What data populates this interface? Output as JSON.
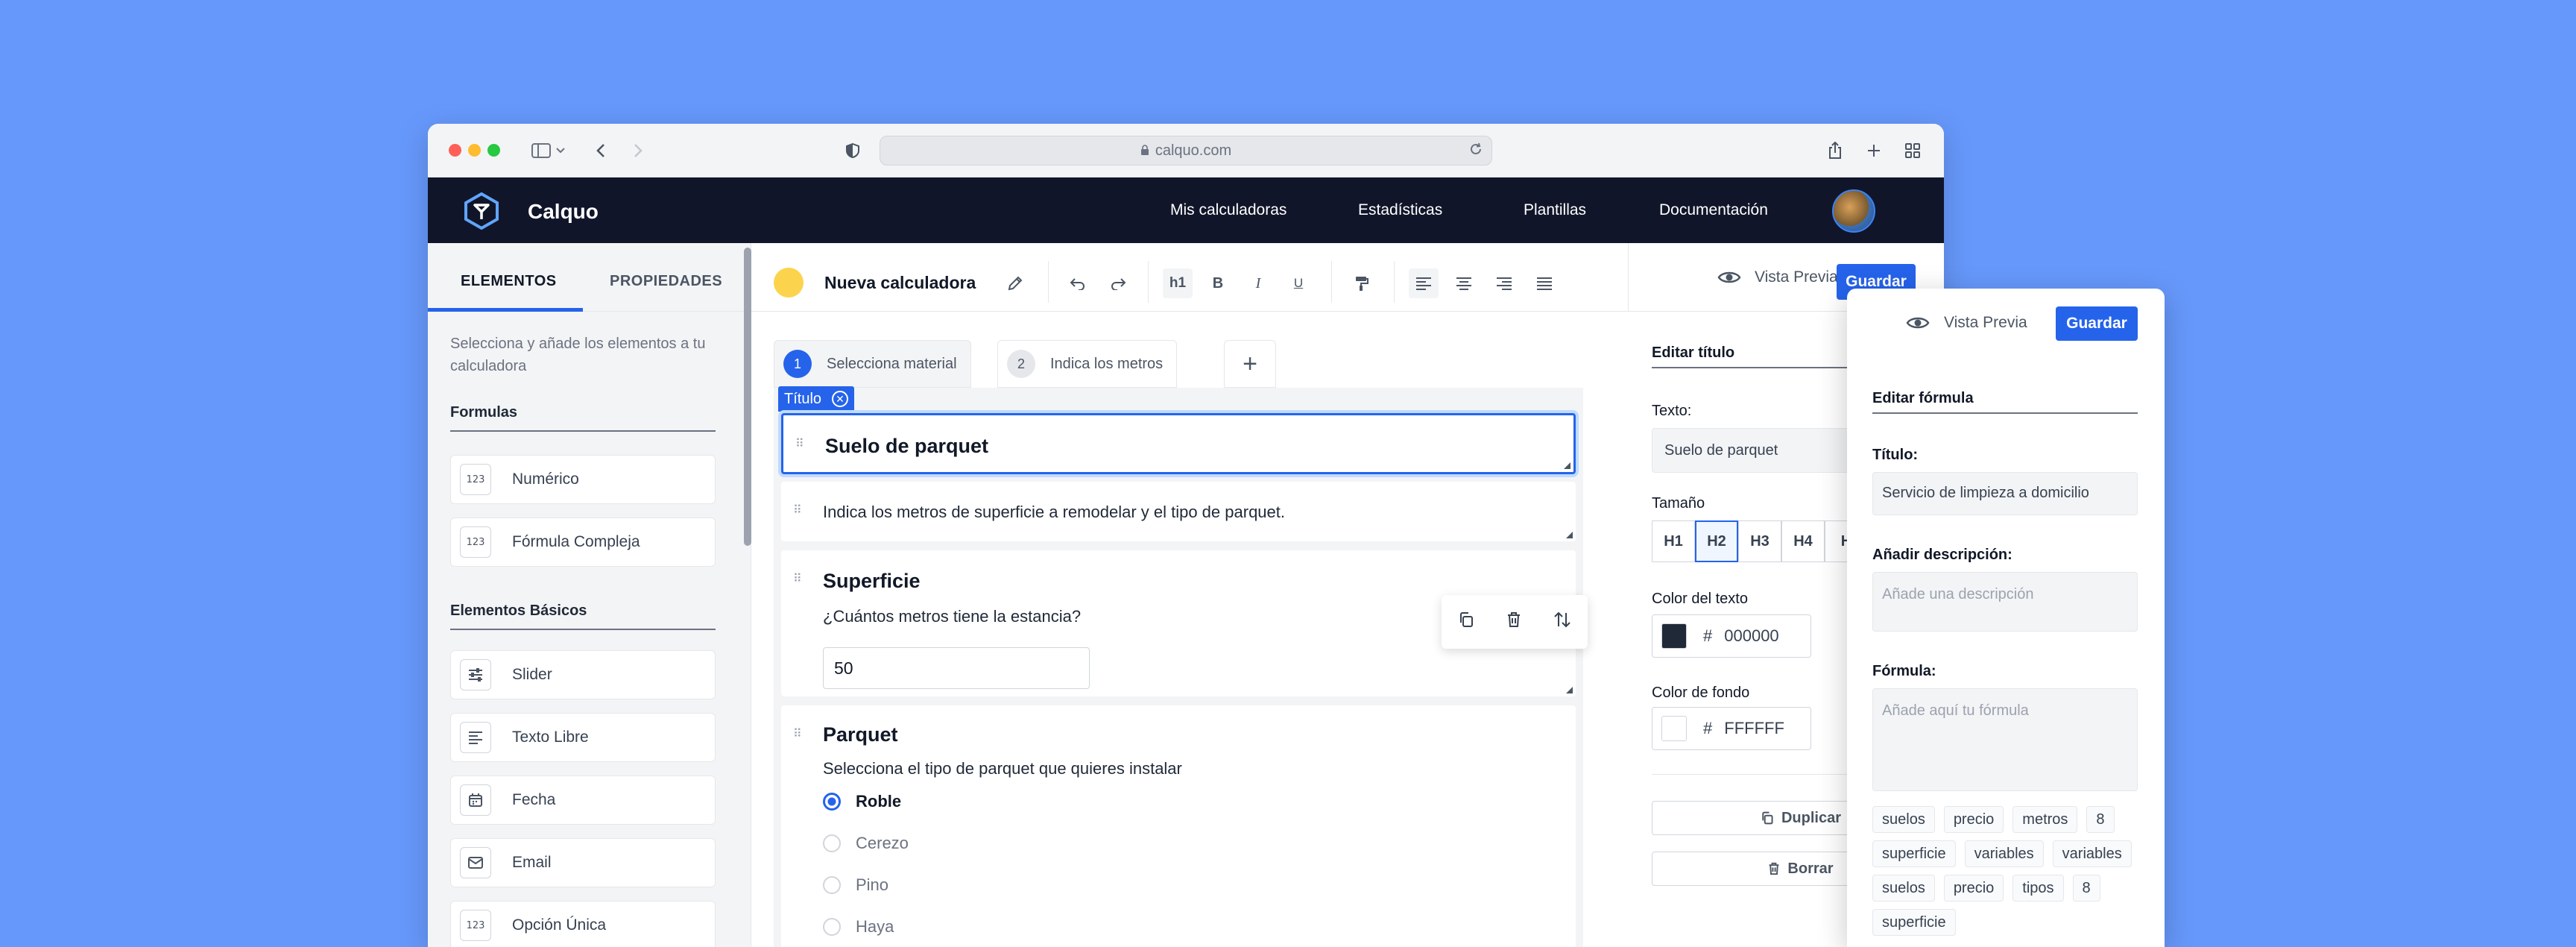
{
  "browser": {
    "url": "calquo.com"
  },
  "app": {
    "brand": "Calquo",
    "nav": [
      "Mis calculadoras",
      "Estadísticas",
      "Plantillas",
      "Documentación"
    ]
  },
  "left_panel": {
    "tabs": [
      "ELEMENTOS",
      "PROPIEDADES"
    ],
    "description": "Selecciona y añade los elementos a tu calculadora",
    "sections": [
      {
        "title": "Formulas",
        "items": [
          {
            "label": "Numérico",
            "icon": "numeric-icon",
            "glyph": "123"
          },
          {
            "label": "Fórmula Compleja",
            "icon": "formula-icon",
            "glyph": "123"
          }
        ]
      },
      {
        "title": "Elementos Básicos",
        "items": [
          {
            "label": "Slider",
            "icon": "slider-icon",
            "glyph": ""
          },
          {
            "label": "Texto Libre",
            "icon": "text-icon",
            "glyph": ""
          },
          {
            "label": "Fecha",
            "icon": "calendar-icon",
            "glyph": ""
          },
          {
            "label": "Email",
            "icon": "email-icon",
            "glyph": ""
          },
          {
            "label": "Opción Única",
            "icon": "single-option-icon",
            "glyph": "123"
          }
        ]
      }
    ]
  },
  "toolbar": {
    "calc_name": "Nueva calculadora",
    "h1_label": "h1",
    "bold_label": "B",
    "italic_label": "I",
    "underline_label": "U",
    "preview_label": "Vista Previa",
    "save_label": "Guardar"
  },
  "steps": [
    {
      "num": "1",
      "label": "Selecciona material"
    },
    {
      "num": "2",
      "label": "Indica los metros"
    }
  ],
  "canvas": {
    "selected_badge": "Título",
    "title_block": "Suelo de parquet",
    "desc_block": "Indica los metros de superficie a remodelar y el tipo de parquet.",
    "superficie": {
      "title": "Superficie",
      "question": "¿Cuántos metros tiene la estancia?",
      "value": "50"
    },
    "parquet": {
      "title": "Parquet",
      "question": "Selecciona el tipo de parquet que quieres instalar",
      "options": [
        "Roble",
        "Cerezo",
        "Pino",
        "Haya"
      ],
      "selected": "Roble"
    }
  },
  "properties": {
    "heading": "Editar título",
    "texto_label": "Texto:",
    "texto_value": "Suelo de parquet",
    "tamano_label": "Tamaño",
    "sizes": [
      "H1",
      "H2",
      "H3",
      "H4",
      "H"
    ],
    "selected_size": "H2",
    "color_texto_label": "Color del texto",
    "color_texto": "000000",
    "color_fondo_label": "Color de fondo",
    "color_fondo": "FFFFFF",
    "hash": "#",
    "duplicate_label": "Duplicar",
    "delete_label": "Borrar"
  },
  "floating_panel": {
    "preview_label": "Vista Previa",
    "save_label": "Guardar",
    "heading": "Editar fórmula",
    "titulo_label": "Título:",
    "titulo_value": "Servicio de limpieza a domicilio",
    "desc_label": "Añadir descripción:",
    "desc_placeholder": "Añade una descripción",
    "formula_label": "Fórmula:",
    "formula_placeholder": "Añade aquí tu fórmula",
    "tags": [
      "suelos",
      "precio",
      "metros",
      "8",
      "superficie",
      "variables",
      "variables",
      "suelos",
      "precio",
      "tipos",
      "8",
      "superficie"
    ]
  },
  "colors": {
    "accent": "#2563eb",
    "header": "#11152a",
    "background": "#6698fb"
  }
}
